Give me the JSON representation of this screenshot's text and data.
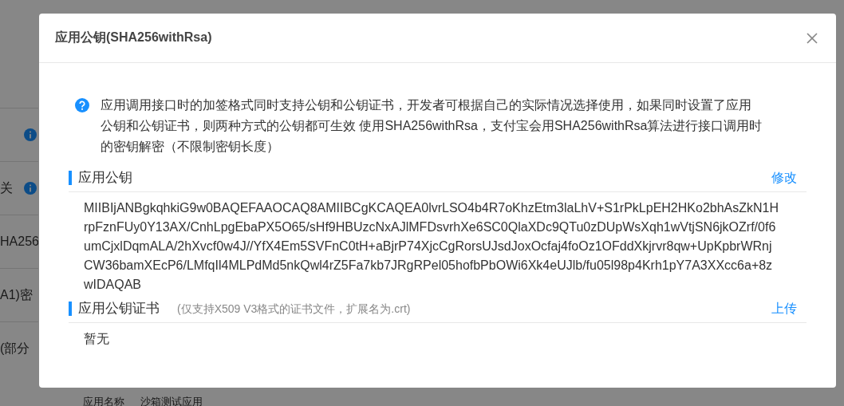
{
  "background_page": {
    "fragments": [
      {
        "info_icon": true
      },
      {
        "text": "关",
        "info_icon": true
      },
      {
        "text": "HA256",
        "info_icon": false
      },
      {
        "text": "A1)密",
        "info_icon": false
      },
      {
        "text": "(部分",
        "info_icon": false
      }
    ],
    "footer_label": "应用名称",
    "footer_value": "沙箱测试应用"
  },
  "dialog": {
    "title": "应用公钥(SHA256withRsa)",
    "notice": "应用调用接口时的加签格式同时支持公钥和公钥证书，开发者可根据自己的实际情况选择使用，如果同时设置了应用公钥和公钥证书，则两种方式的公钥都可生效 使用SHA256withRsa，支付宝会用SHA256withRsa算法进行接口调用时的密钥解密（不限制密钥长度）",
    "sections": [
      {
        "title": "应用公钥",
        "action": "修改",
        "content": "MIIBIjANBgkqhkiG9w0BAQEFAAOCAQ8AMIIBCgKCAQEA0lvrLSO4b4R7oKhzEtm3laLhV+S1rPkLpEH2HKo2bhAsZkN1HrpFznFUy0Y13AX/CnhLpgEbaPX5O65/sHf9HBUzcNxAJlMFDsvrhXe6SC0QlaXDc9QTu0zDUpWsXqh1wVtjSN6jkOZrf/0f6umCjxlDqmALA/2hXvcf0w4J//YfX4Em5SVFnC0tH+aBjrP74XjcCgRorsUJsdJoxOcfaj4foOz1OFddXkjrvr8qw+UpKpbrWRnjCW36bamXEcP6/LMfqIl4MLPdMd5nkQwl4rZ5Fa7kb7JRgRPel05hofbPbOWi6Xk4eUJlb/fu05l98p4Krh1pY7A3XXcc6a+8zwIDAQAB"
      },
      {
        "title": "应用公钥证书",
        "hint": "(仅支持X509 V3格式的证书文件，扩展名为.crt)",
        "action": "上传",
        "content": "暂无"
      }
    ]
  }
}
